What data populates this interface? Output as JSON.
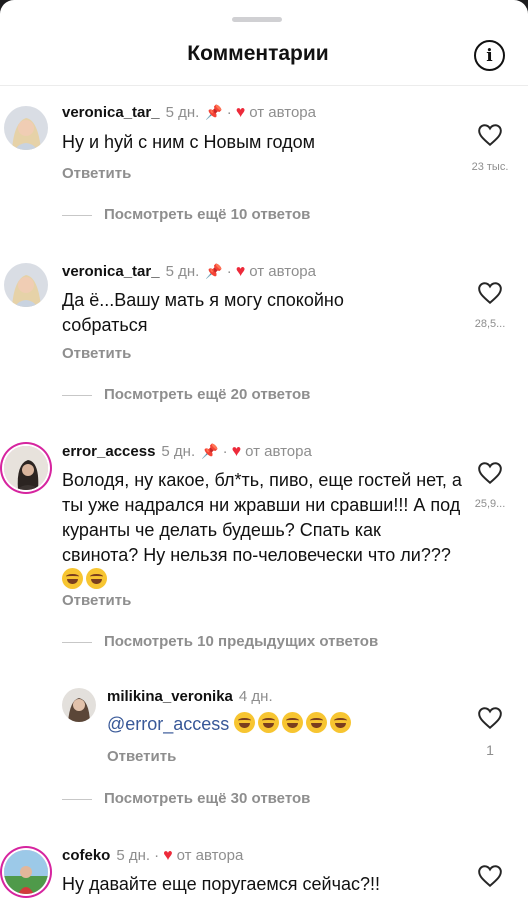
{
  "header": {
    "title": "Комментарии",
    "info_icon": "i"
  },
  "comments": [
    {
      "user": "veronica_tar_",
      "time": "5 дн.",
      "author_badge": "от автора",
      "text": "Ну и hуй с ним с Новым годом",
      "reply_label": "Ответить",
      "likes": "23 тыс.",
      "more_label": "Посмотреть ещё 10 ответов"
    },
    {
      "user": "veronica_tar_",
      "time": "5 дн.",
      "author_badge": "от автора",
      "text": "Да ё...Вашу мать я могу спокойно собраться",
      "reply_label": "Ответить",
      "likes": "28,5...",
      "more_label": "Посмотреть ещё 20 ответов"
    },
    {
      "user": "error_access",
      "time": "5 дн.",
      "author_badge": "от автора",
      "text": "Володя, ну какое, бл*ть, пиво, еще гостей нет, а ты уже надрался ни жравши ни сравши!!! А под куранты че делать будешь? Спать как свинота? Ну нельзя по-человечески что ли???",
      "reply_label": "Ответить",
      "likes": "25,9...",
      "more_label": "Посмотреть 10 предыдущих ответов"
    },
    {
      "user": "milikina_veronika",
      "time": "4 дн.",
      "mention": "@error_access",
      "reply_label": "Ответить",
      "likes": "1",
      "more_label": "Посмотреть ещё 30 ответов"
    },
    {
      "user": "cofeko",
      "time": "5 дн.",
      "author_badge": "от автора",
      "text": "Ну давайте еще поругаемся сейчас?!!"
    }
  ],
  "colors": {
    "author_heart": "#ed2a3a",
    "mention": "#385898",
    "story_ring": "#d6249f",
    "muted": "#8e8e8e"
  }
}
